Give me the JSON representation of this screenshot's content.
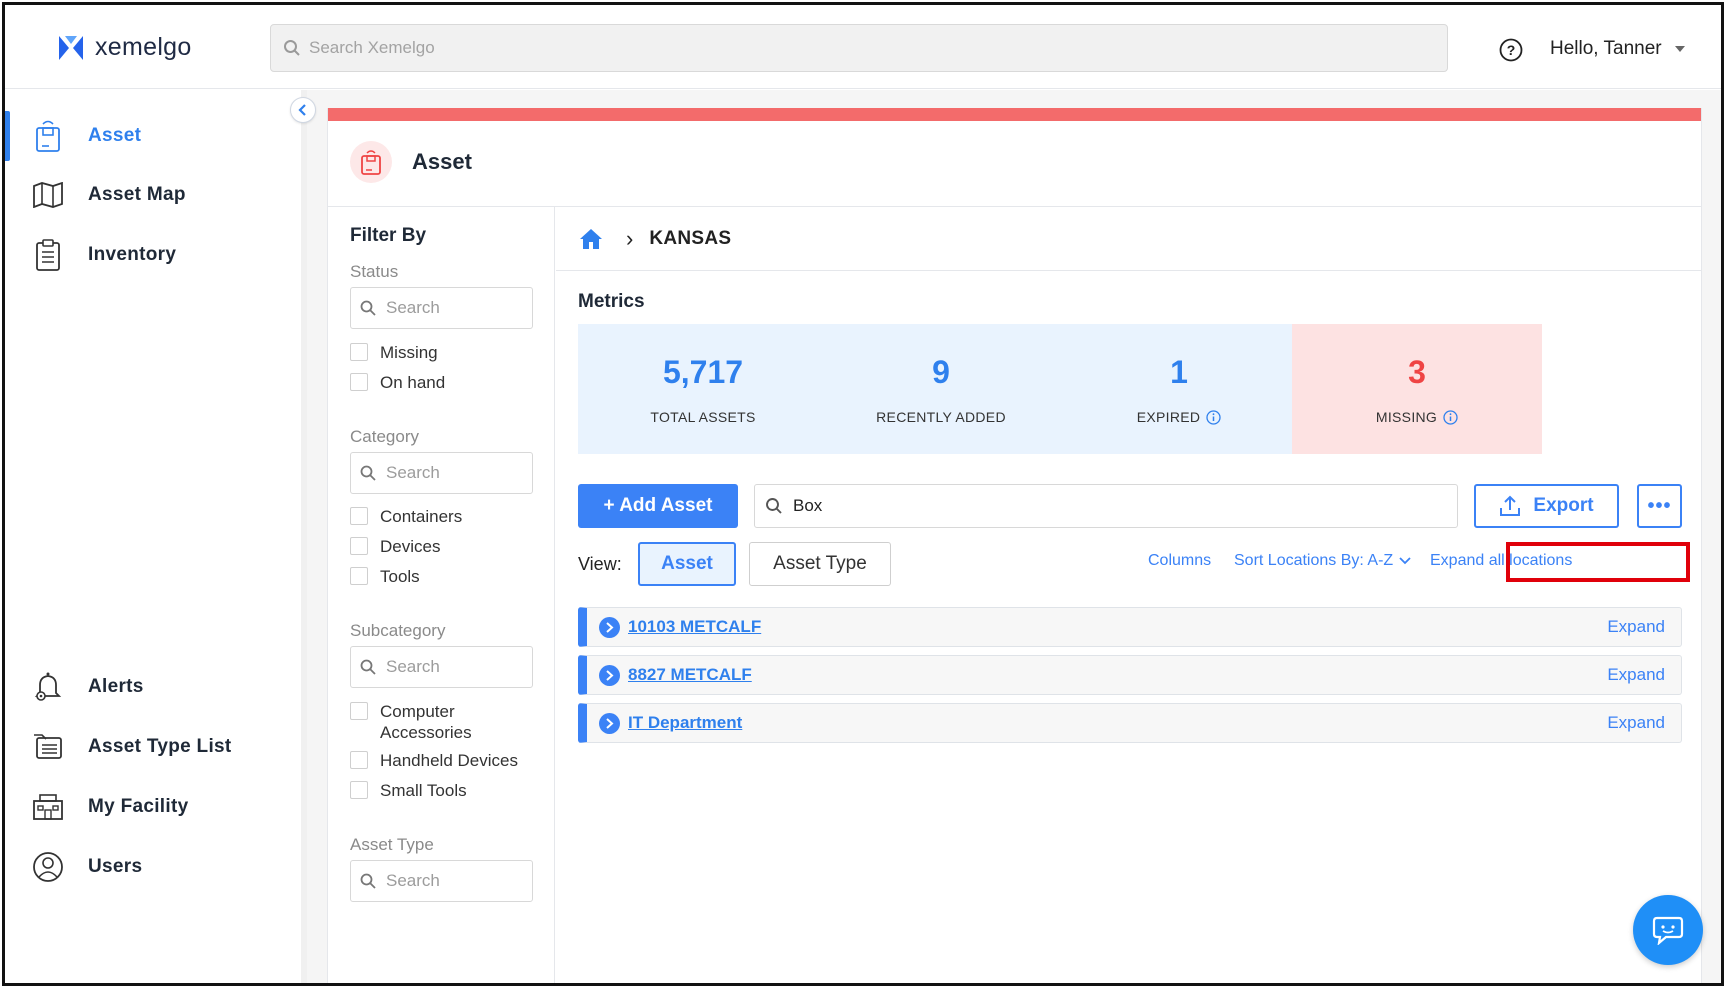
{
  "header": {
    "logo_text": "xemelgo",
    "search_placeholder": "Search Xemelgo",
    "user_greeting": "Hello, Tanner"
  },
  "sidebar": {
    "top_items": [
      {
        "label": "Asset",
        "icon": "asset-tag-icon",
        "active": true
      },
      {
        "label": "Asset Map",
        "icon": "map-icon",
        "active": false
      },
      {
        "label": "Inventory",
        "icon": "clipboard-icon",
        "active": false
      }
    ],
    "bottom_items": [
      {
        "label": "Alerts",
        "icon": "bell-icon"
      },
      {
        "label": "Asset Type List",
        "icon": "list-icon"
      },
      {
        "label": "My Facility",
        "icon": "building-icon"
      },
      {
        "label": "Users",
        "icon": "user-icon"
      }
    ]
  },
  "page": {
    "title": "Asset",
    "accent_color": "#f36b6b",
    "brand_blue": "#3b82f6"
  },
  "filter": {
    "title": "Filter By",
    "sections": [
      {
        "title": "Status",
        "search_placeholder": "Search",
        "options": [
          "Missing",
          "On hand"
        ]
      },
      {
        "title": "Category",
        "search_placeholder": "Search",
        "options": [
          "Containers",
          "Devices",
          "Tools"
        ]
      },
      {
        "title": "Subcategory",
        "search_placeholder": "Search",
        "options": [
          "Computer Accessories",
          "Handheld Devices",
          "Small Tools"
        ]
      },
      {
        "title": "Asset Type",
        "search_placeholder": "Search",
        "options": []
      }
    ]
  },
  "breadcrumb": {
    "current": "KANSAS"
  },
  "metrics": {
    "label": "Metrics",
    "cards": [
      {
        "value": "5,717",
        "label": "TOTAL ASSETS",
        "info": false
      },
      {
        "value": "9",
        "label": "RECENTLY ADDED",
        "info": false
      },
      {
        "value": "1",
        "label": "EXPIRED",
        "info": true
      },
      {
        "value": "3",
        "label": "MISSING",
        "info": true
      }
    ]
  },
  "toolbar": {
    "add_label": "+ Add Asset",
    "search_value": "Box",
    "export_label": "Export",
    "more_label": "•••"
  },
  "view": {
    "label": "View:",
    "active": "Asset",
    "inactive": "Asset Type",
    "columns_link": "Columns",
    "sort_link": "Sort Locations By: A-Z",
    "expand_all_link": "Expand all locations"
  },
  "locations": [
    {
      "name": "10103 METCALF",
      "action": "Expand"
    },
    {
      "name": "8827 METCALF",
      "action": "Expand"
    },
    {
      "name": "IT Department",
      "action": "Expand"
    }
  ]
}
